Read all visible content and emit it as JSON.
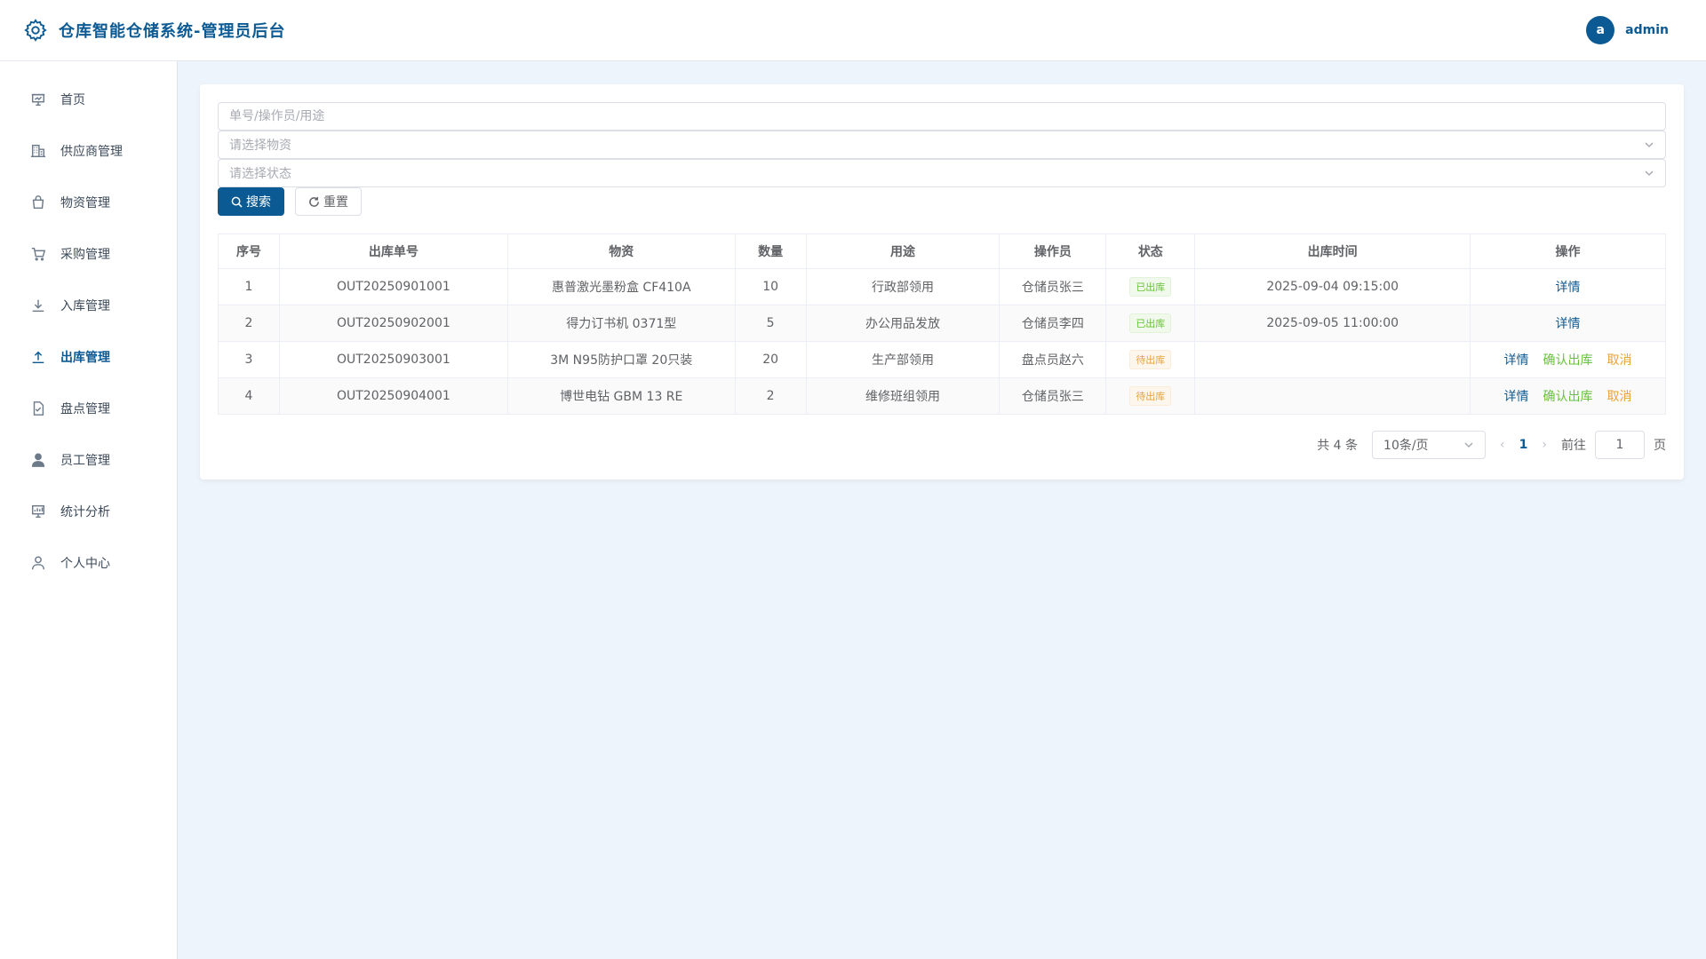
{
  "header": {
    "title": "仓库智能仓储系统-管理员后台",
    "avatar_letter": "a",
    "username": "admin"
  },
  "sidebar": {
    "items": [
      {
        "label": "首页",
        "icon": "presentation-icon",
        "active": false
      },
      {
        "label": "供应商管理",
        "icon": "building-icon",
        "active": false
      },
      {
        "label": "物资管理",
        "icon": "bag-icon",
        "active": false
      },
      {
        "label": "采购管理",
        "icon": "cart-icon",
        "active": false
      },
      {
        "label": "入库管理",
        "icon": "download-icon",
        "active": false
      },
      {
        "label": "出库管理",
        "icon": "upload-icon",
        "active": true
      },
      {
        "label": "盘点管理",
        "icon": "checklist-icon",
        "active": false
      },
      {
        "label": "员工管理",
        "icon": "user-filled-icon",
        "active": false
      },
      {
        "label": "统计分析",
        "icon": "chart-board-icon",
        "active": false
      },
      {
        "label": "个人中心",
        "icon": "user-icon",
        "active": false
      }
    ]
  },
  "filters": {
    "keyword_placeholder": "单号/操作员/用途",
    "material_placeholder": "请选择物资",
    "status_placeholder": "请选择状态",
    "search_label": "搜索",
    "reset_label": "重置"
  },
  "table": {
    "columns": [
      "序号",
      "出库单号",
      "物资",
      "数量",
      "用途",
      "操作员",
      "状态",
      "出库时间",
      "操作"
    ],
    "rows": [
      {
        "no": "1",
        "order": "OUT20250901001",
        "material": "惠普激光墨粉盒 CF410A",
        "qty": "10",
        "purpose": "行政部领用",
        "operator": "仓储员张三",
        "status": "已出库",
        "time": "2025-09-04 09:15:00"
      },
      {
        "no": "2",
        "order": "OUT20250902001",
        "material": "得力订书机 0371型",
        "qty": "5",
        "purpose": "办公用品发放",
        "operator": "仓储员李四",
        "status": "已出库",
        "time": "2025-09-05 11:00:00"
      },
      {
        "no": "3",
        "order": "OUT20250903001",
        "material": "3M N95防护口罩 20只装",
        "qty": "20",
        "purpose": "生产部领用",
        "operator": "盘点员赵六",
        "status": "待出库",
        "time": ""
      },
      {
        "no": "4",
        "order": "OUT20250904001",
        "material": "博世电钻 GBM 13 RE",
        "qty": "2",
        "purpose": "维修班组领用",
        "operator": "仓储员张三",
        "status": "待出库",
        "time": ""
      }
    ],
    "actions": {
      "detail": "详情",
      "confirm": "确认出库",
      "cancel": "取消"
    }
  },
  "pagination": {
    "total_text": "共 4 条",
    "page_size": "10条/页",
    "current_page": "1",
    "goto_label": "前往",
    "goto_value": "1",
    "page_suffix": "页"
  },
  "colors": {
    "brand": "#0c5a93",
    "success": "#67c23a",
    "warning": "#e6a23c",
    "background": "#eef4fb"
  }
}
